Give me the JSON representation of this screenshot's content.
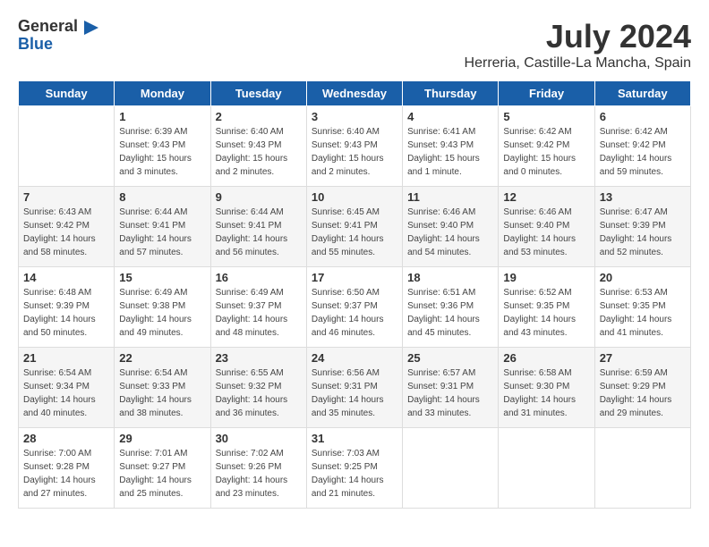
{
  "header": {
    "logo_general": "General",
    "logo_blue": "Blue",
    "month_title": "July 2024",
    "location": "Herreria, Castille-La Mancha, Spain"
  },
  "calendar": {
    "days_of_week": [
      "Sunday",
      "Monday",
      "Tuesday",
      "Wednesday",
      "Thursday",
      "Friday",
      "Saturday"
    ],
    "weeks": [
      [
        {
          "day": "",
          "info": ""
        },
        {
          "day": "1",
          "info": "Sunrise: 6:39 AM\nSunset: 9:43 PM\nDaylight: 15 hours\nand 3 minutes."
        },
        {
          "day": "2",
          "info": "Sunrise: 6:40 AM\nSunset: 9:43 PM\nDaylight: 15 hours\nand 2 minutes."
        },
        {
          "day": "3",
          "info": "Sunrise: 6:40 AM\nSunset: 9:43 PM\nDaylight: 15 hours\nand 2 minutes."
        },
        {
          "day": "4",
          "info": "Sunrise: 6:41 AM\nSunset: 9:43 PM\nDaylight: 15 hours\nand 1 minute."
        },
        {
          "day": "5",
          "info": "Sunrise: 6:42 AM\nSunset: 9:42 PM\nDaylight: 15 hours\nand 0 minutes."
        },
        {
          "day": "6",
          "info": "Sunrise: 6:42 AM\nSunset: 9:42 PM\nDaylight: 14 hours\nand 59 minutes."
        }
      ],
      [
        {
          "day": "7",
          "info": "Sunrise: 6:43 AM\nSunset: 9:42 PM\nDaylight: 14 hours\nand 58 minutes."
        },
        {
          "day": "8",
          "info": "Sunrise: 6:44 AM\nSunset: 9:41 PM\nDaylight: 14 hours\nand 57 minutes."
        },
        {
          "day": "9",
          "info": "Sunrise: 6:44 AM\nSunset: 9:41 PM\nDaylight: 14 hours\nand 56 minutes."
        },
        {
          "day": "10",
          "info": "Sunrise: 6:45 AM\nSunset: 9:41 PM\nDaylight: 14 hours\nand 55 minutes."
        },
        {
          "day": "11",
          "info": "Sunrise: 6:46 AM\nSunset: 9:40 PM\nDaylight: 14 hours\nand 54 minutes."
        },
        {
          "day": "12",
          "info": "Sunrise: 6:46 AM\nSunset: 9:40 PM\nDaylight: 14 hours\nand 53 minutes."
        },
        {
          "day": "13",
          "info": "Sunrise: 6:47 AM\nSunset: 9:39 PM\nDaylight: 14 hours\nand 52 minutes."
        }
      ],
      [
        {
          "day": "14",
          "info": "Sunrise: 6:48 AM\nSunset: 9:39 PM\nDaylight: 14 hours\nand 50 minutes."
        },
        {
          "day": "15",
          "info": "Sunrise: 6:49 AM\nSunset: 9:38 PM\nDaylight: 14 hours\nand 49 minutes."
        },
        {
          "day": "16",
          "info": "Sunrise: 6:49 AM\nSunset: 9:37 PM\nDaylight: 14 hours\nand 48 minutes."
        },
        {
          "day": "17",
          "info": "Sunrise: 6:50 AM\nSunset: 9:37 PM\nDaylight: 14 hours\nand 46 minutes."
        },
        {
          "day": "18",
          "info": "Sunrise: 6:51 AM\nSunset: 9:36 PM\nDaylight: 14 hours\nand 45 minutes."
        },
        {
          "day": "19",
          "info": "Sunrise: 6:52 AM\nSunset: 9:35 PM\nDaylight: 14 hours\nand 43 minutes."
        },
        {
          "day": "20",
          "info": "Sunrise: 6:53 AM\nSunset: 9:35 PM\nDaylight: 14 hours\nand 41 minutes."
        }
      ],
      [
        {
          "day": "21",
          "info": "Sunrise: 6:54 AM\nSunset: 9:34 PM\nDaylight: 14 hours\nand 40 minutes."
        },
        {
          "day": "22",
          "info": "Sunrise: 6:54 AM\nSunset: 9:33 PM\nDaylight: 14 hours\nand 38 minutes."
        },
        {
          "day": "23",
          "info": "Sunrise: 6:55 AM\nSunset: 9:32 PM\nDaylight: 14 hours\nand 36 minutes."
        },
        {
          "day": "24",
          "info": "Sunrise: 6:56 AM\nSunset: 9:31 PM\nDaylight: 14 hours\nand 35 minutes."
        },
        {
          "day": "25",
          "info": "Sunrise: 6:57 AM\nSunset: 9:31 PM\nDaylight: 14 hours\nand 33 minutes."
        },
        {
          "day": "26",
          "info": "Sunrise: 6:58 AM\nSunset: 9:30 PM\nDaylight: 14 hours\nand 31 minutes."
        },
        {
          "day": "27",
          "info": "Sunrise: 6:59 AM\nSunset: 9:29 PM\nDaylight: 14 hours\nand 29 minutes."
        }
      ],
      [
        {
          "day": "28",
          "info": "Sunrise: 7:00 AM\nSunset: 9:28 PM\nDaylight: 14 hours\nand 27 minutes."
        },
        {
          "day": "29",
          "info": "Sunrise: 7:01 AM\nSunset: 9:27 PM\nDaylight: 14 hours\nand 25 minutes."
        },
        {
          "day": "30",
          "info": "Sunrise: 7:02 AM\nSunset: 9:26 PM\nDaylight: 14 hours\nand 23 minutes."
        },
        {
          "day": "31",
          "info": "Sunrise: 7:03 AM\nSunset: 9:25 PM\nDaylight: 14 hours\nand 21 minutes."
        },
        {
          "day": "",
          "info": ""
        },
        {
          "day": "",
          "info": ""
        },
        {
          "day": "",
          "info": ""
        }
      ]
    ]
  }
}
